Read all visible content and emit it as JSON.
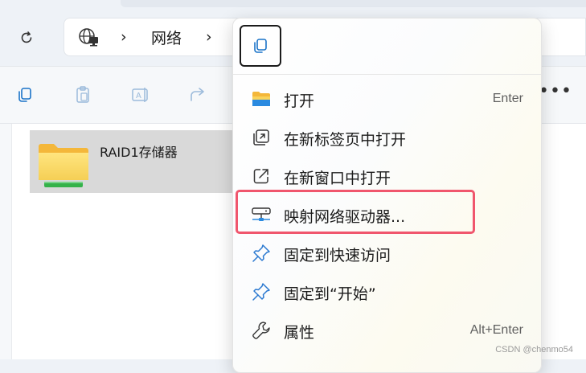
{
  "address_bar": {
    "breadcrumb_network": "网络",
    "separator": "›"
  },
  "icons": {
    "refresh": "refresh-icon",
    "network": "network-globe-icon",
    "copy": "copy-icon",
    "paste": "paste-icon",
    "rename": "rename-icon",
    "share": "share-icon"
  },
  "toolbar": {
    "more": "•••"
  },
  "file": {
    "name": "RAID1存储器"
  },
  "context_menu": {
    "items": [
      {
        "label": "打开",
        "shortcut": "Enter",
        "icon": "folder-icon"
      },
      {
        "label": "在新标签页中打开",
        "shortcut": "",
        "icon": "new-tab-icon"
      },
      {
        "label": "在新窗口中打开",
        "shortcut": "",
        "icon": "new-window-icon"
      },
      {
        "label": "映射网络驱动器...",
        "shortcut": "",
        "icon": "network-drive-icon"
      },
      {
        "label": "固定到快速访问",
        "shortcut": "",
        "icon": "pin-icon"
      },
      {
        "label": "固定到“开始”",
        "shortcut": "",
        "icon": "pin-icon"
      },
      {
        "label": "属性",
        "shortcut": "Alt+Enter",
        "icon": "wrench-icon"
      }
    ]
  },
  "watermark": "CSDN @chenmo54",
  "colors": {
    "highlight_border": "#f0566d",
    "accent_blue": "#1a73c8",
    "folder_yellow": "#f7c948",
    "drive_green": "#35b24a"
  }
}
